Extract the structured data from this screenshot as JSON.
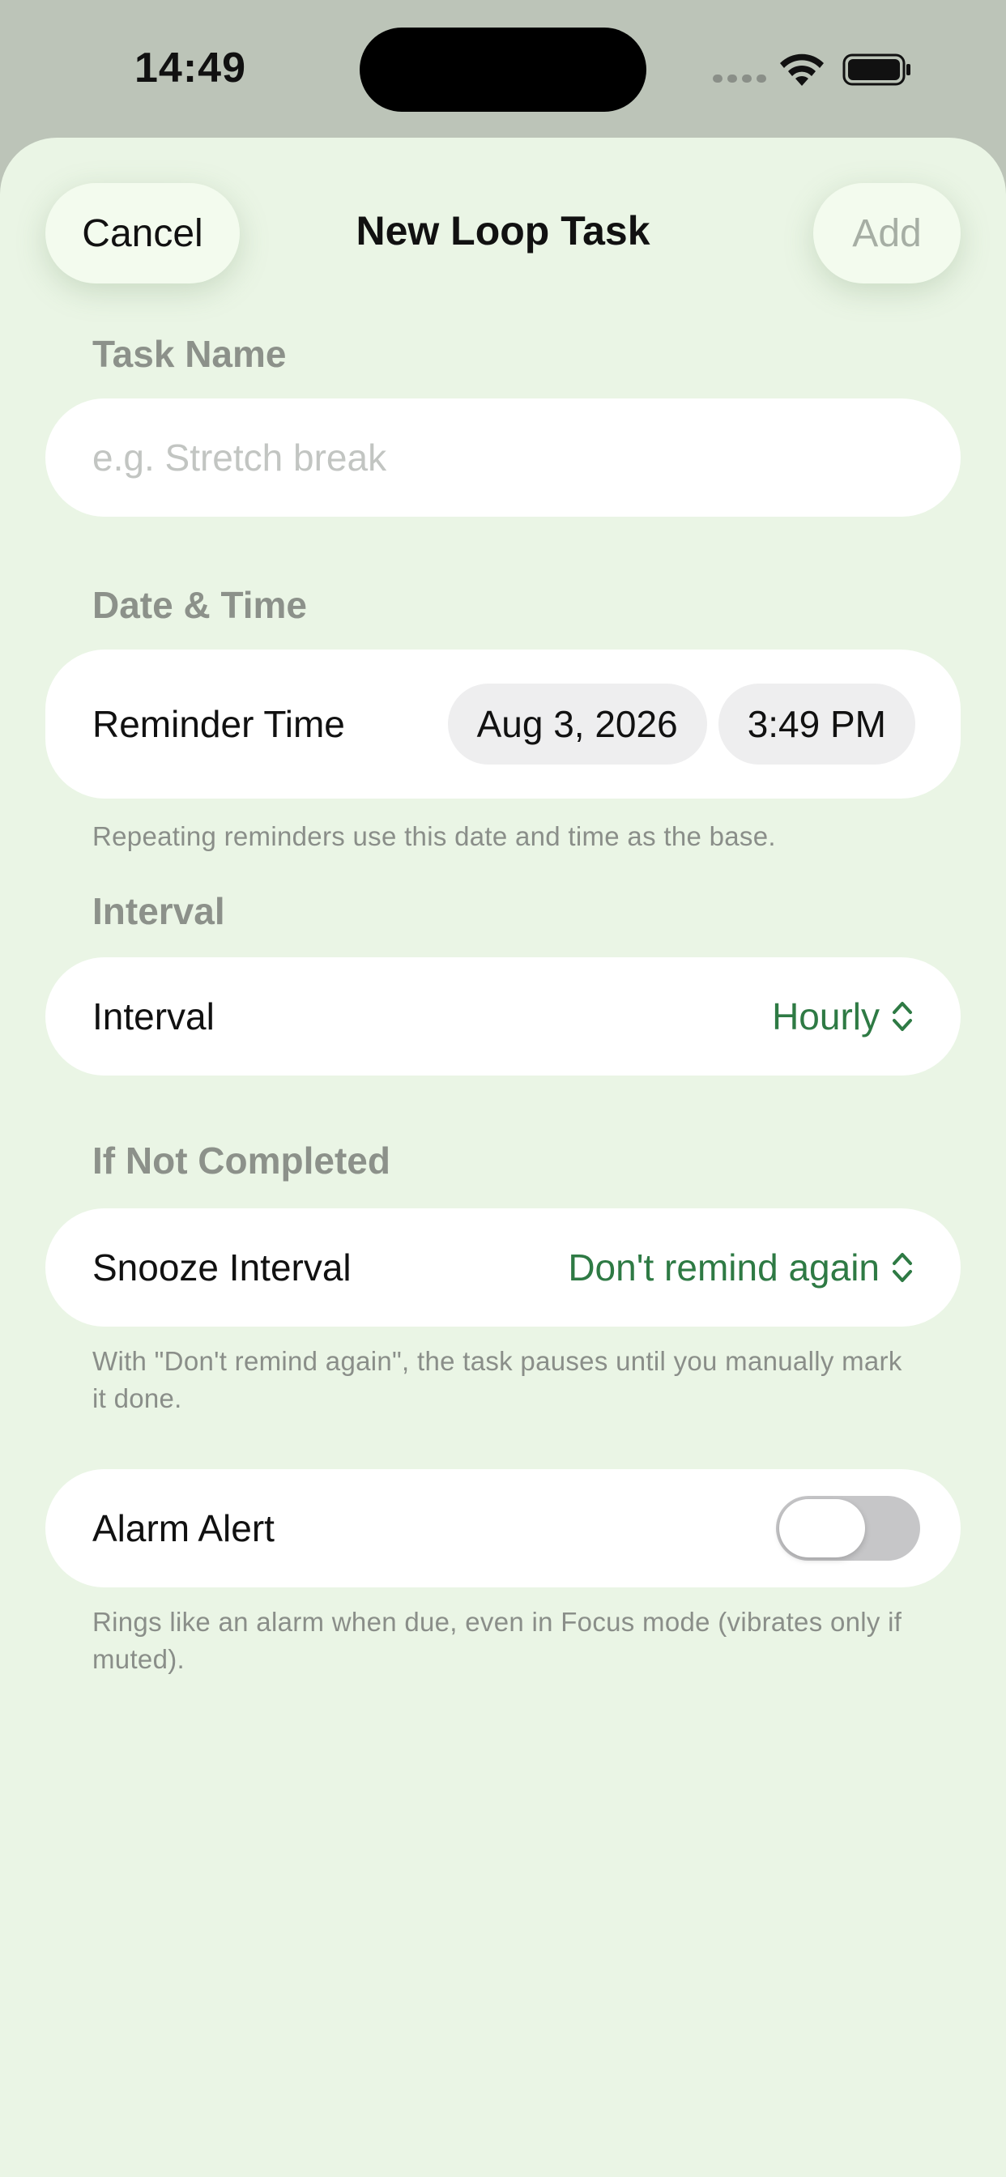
{
  "status_bar": {
    "time": "14:49",
    "icons": [
      "signal-dots-icon",
      "wifi-icon",
      "battery-icon"
    ]
  },
  "nav": {
    "cancel_label": "Cancel",
    "title": "New Loop Task",
    "add_label": "Add"
  },
  "task_name": {
    "header": "Task Name",
    "value": "",
    "placeholder": "e.g. Stretch break"
  },
  "date_time": {
    "header": "Date & Time",
    "label": "Reminder Time",
    "date": "Aug 3, 2026",
    "time": "3:49 PM",
    "footnote": "Repeating reminders use this date and time as the base."
  },
  "interval": {
    "header": "Interval",
    "label": "Interval",
    "value": "Hourly"
  },
  "not_completed": {
    "header": "If Not Completed",
    "label": "Snooze Interval",
    "value": "Don't remind again",
    "footnote": "With \"Don't remind again\", the task pauses until you manually mark it done."
  },
  "alarm": {
    "label": "Alarm Alert",
    "enabled": false,
    "footnote": "Rings like an alarm when due, even in Focus mode (vibrates only if muted)."
  },
  "colors": {
    "sheet_background": "#eaf5e5",
    "accent_green": "#2e7a44",
    "header_gray": "#8c918a"
  }
}
